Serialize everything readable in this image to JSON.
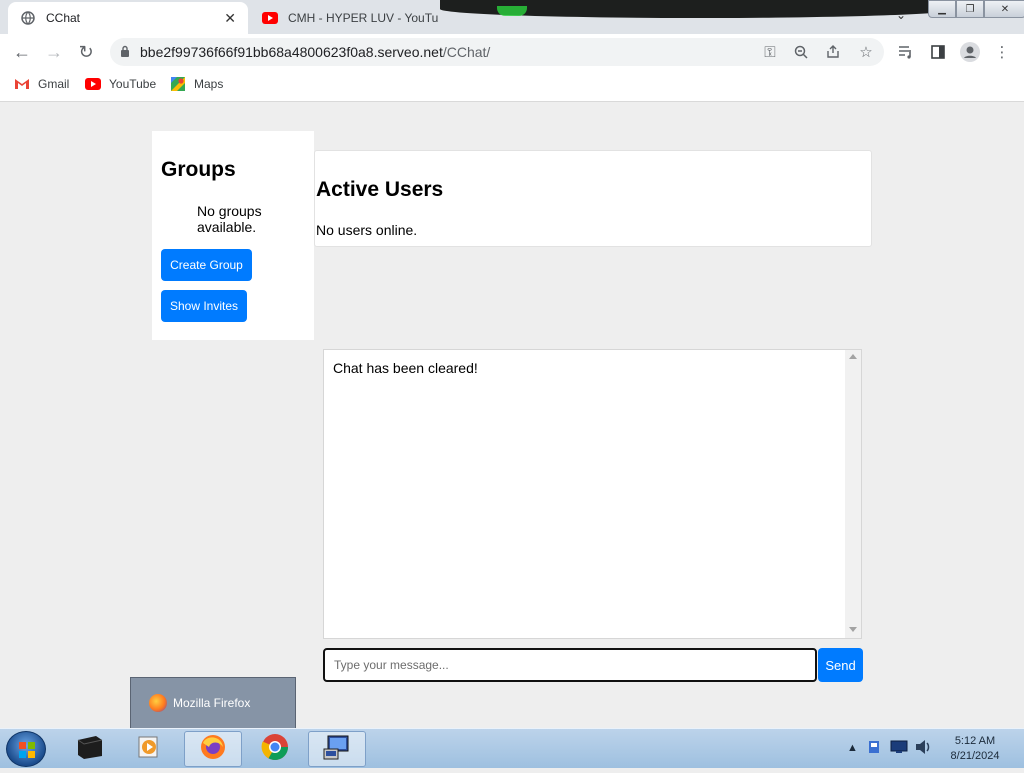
{
  "browser": {
    "tabs": [
      {
        "title": "CChat",
        "active": true
      },
      {
        "title": "CMH - HYPER LUV - YouTu",
        "active": false
      }
    ],
    "url": {
      "host": "bbe2f99736f66f91bb68a4800623f0a8.serveo.net",
      "path": "/CChat/"
    },
    "bookmarks": [
      {
        "label": "Gmail",
        "icon": "gmail-icon"
      },
      {
        "label": "YouTube",
        "icon": "youtube-icon"
      },
      {
        "label": "Maps",
        "icon": "maps-icon"
      }
    ]
  },
  "groups": {
    "title": "Groups",
    "empty_text": "No groups available.",
    "create_label": "Create Group",
    "invites_label": "Show Invites"
  },
  "users": {
    "title": "Active Users",
    "empty_text": "No users online."
  },
  "chat": {
    "messages": [
      "Chat has been cleared!"
    ],
    "input_placeholder": "Type your message...",
    "send_label": "Send"
  },
  "taskbar": {
    "popup_label": "Mozilla Firefox",
    "time": "5:12 AM",
    "date": "8/21/2024"
  },
  "colors": {
    "primary": "#007bff",
    "page_bg": "#eeeeee"
  }
}
